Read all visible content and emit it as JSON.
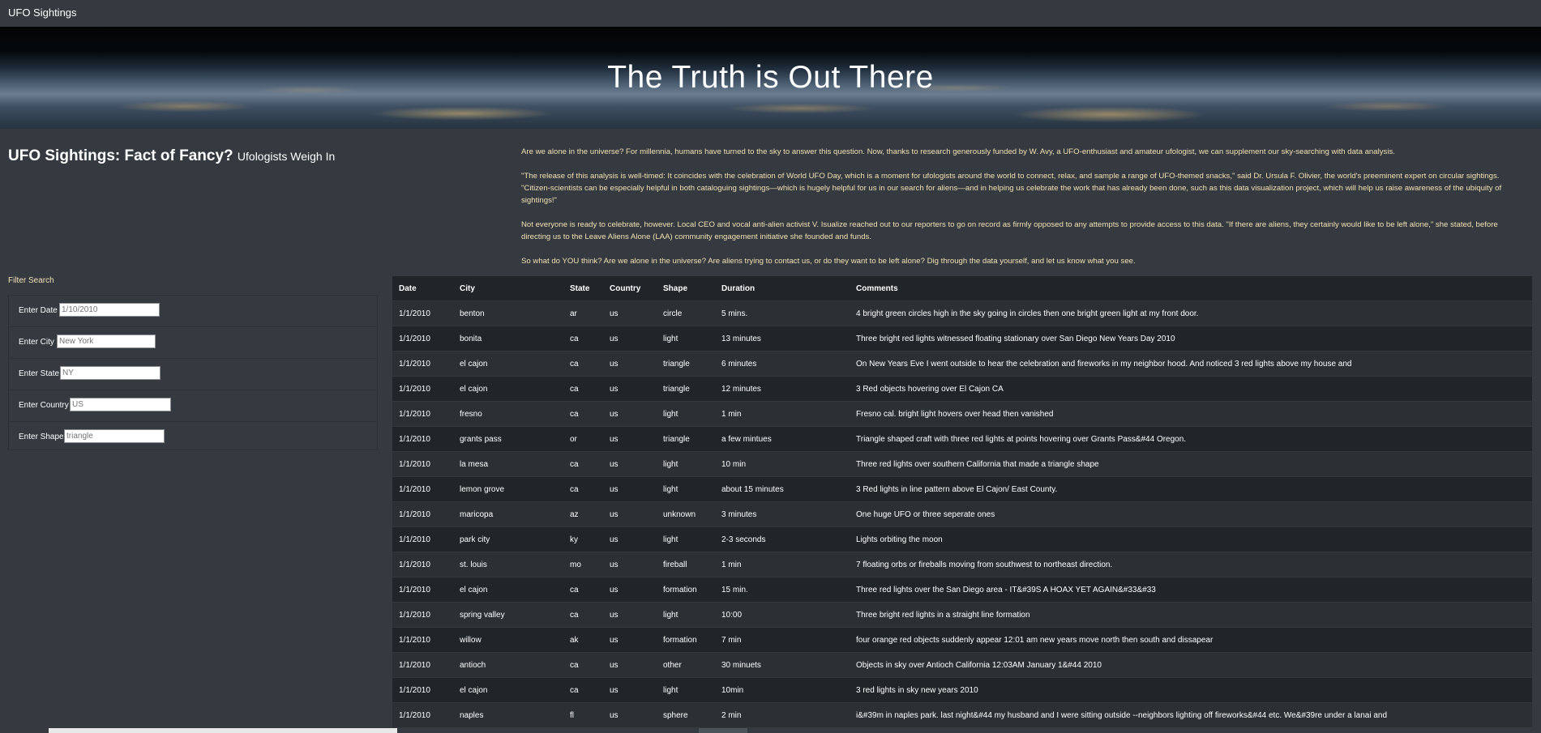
{
  "navbar": {
    "brand": "UFO Sightings"
  },
  "hero": {
    "title": "The Truth is Out There"
  },
  "intro": {
    "title": "UFO Sightings: Fact of Fancy?",
    "subtitle": "Ufologists Weigh In",
    "paragraphs": [
      "Are we alone in the universe? For millennia, humans have turned to the sky to answer this question. Now, thanks to research generously funded by W. Avy, a UFO-enthusiast and amateur ufologist, we can supplement our sky-searching with data analysis.",
      "\"The release of this analysis is well-timed: It coincides with the celebration of World UFO Day, which is a moment for ufologists around the world to connect, relax, and sample a range of UFO-themed snacks,\" said Dr. Ursula F. Olivier, the world's preeminent expert on circular sightings. \"Citizen-scientists can be especially helpful in both cataloguing sightings—which is hugely helpful for us in our search for aliens—and in helping us celebrate the work that has already been done, such as this data visualization project, which will help us raise awareness of the ubiquity of sightings!\"",
      "Not everyone is ready to celebrate, however. Local CEO and vocal anti-alien activist V. Isualize reached out to our reporters to go on record as firmly opposed to any attempts to provide access to this data. \"If there are aliens, they certainly would like to be left alone,\" she stated, before directing us to the Leave Aliens Alone (LAA) community engagement initiative she founded and funds.",
      "So what do YOU think? Are we alone in the universe? Are aliens trying to contact us, or do they want to be left alone? Dig through the data yourself, and let us know what you see."
    ]
  },
  "filters": {
    "label": "Filter Search",
    "date": {
      "label": "Enter Date",
      "placeholder": "1/10/2010"
    },
    "city": {
      "label": "Enter City",
      "placeholder": "New York"
    },
    "state": {
      "label": "Enter State",
      "placeholder": "NY"
    },
    "country": {
      "label": "Enter Country",
      "placeholder": "US"
    },
    "shape": {
      "label": "Enter Shape",
      "placeholder": "triangle"
    }
  },
  "table": {
    "headers": [
      "Date",
      "City",
      "State",
      "Country",
      "Shape",
      "Duration",
      "Comments"
    ],
    "rows": [
      [
        "1/1/2010",
        "benton",
        "ar",
        "us",
        "circle",
        "5 mins.",
        "4 bright green circles high in the sky going in circles then one bright green light at my front door."
      ],
      [
        "1/1/2010",
        "bonita",
        "ca",
        "us",
        "light",
        "13 minutes",
        "Three bright red lights witnessed floating stationary over San Diego New Years Day 2010"
      ],
      [
        "1/1/2010",
        "el cajon",
        "ca",
        "us",
        "triangle",
        "6 minutes",
        "On New Years Eve I went outside to hear the celebration and fireworks in my neighbor hood. And noticed 3 red lights above my house and"
      ],
      [
        "1/1/2010",
        "el cajon",
        "ca",
        "us",
        "triangle",
        "12 minutes",
        "3 Red objects hovering over El Cajon CA"
      ],
      [
        "1/1/2010",
        "fresno",
        "ca",
        "us",
        "light",
        "1 min",
        "Fresno cal. bright light hovers over head then vanished"
      ],
      [
        "1/1/2010",
        "grants pass",
        "or",
        "us",
        "triangle",
        "a few mintues",
        "Triangle shaped craft with three red lights at points hovering over Grants Pass&#44 Oregon."
      ],
      [
        "1/1/2010",
        "la mesa",
        "ca",
        "us",
        "light",
        "10 min",
        "Three red lights over southern California that made a triangle shape"
      ],
      [
        "1/1/2010",
        "lemon grove",
        "ca",
        "us",
        "light",
        "about 15 minutes",
        "3 Red lights in line pattern above El Cajon/ East County."
      ],
      [
        "1/1/2010",
        "maricopa",
        "az",
        "us",
        "unknown",
        "3 minutes",
        "One huge UFO or three seperate ones"
      ],
      [
        "1/1/2010",
        "park city",
        "ky",
        "us",
        "light",
        "2-3 seconds",
        "Lights orbiting the moon"
      ],
      [
        "1/1/2010",
        "st. louis",
        "mo",
        "us",
        "fireball",
        "1 min",
        "7 floating orbs or fireballs moving from southwest to northeast direction."
      ],
      [
        "1/1/2010",
        "el cajon",
        "ca",
        "us",
        "formation",
        "15 min.",
        "Three red lights over the San Diego area - IT&#39S A HOAX YET AGAIN&#33&#33"
      ],
      [
        "1/1/2010",
        "spring valley",
        "ca",
        "us",
        "light",
        "10:00",
        "Three bright red lights in a straight line formation"
      ],
      [
        "1/1/2010",
        "willow",
        "ak",
        "us",
        "formation",
        "7 min",
        "four orange red objects suddenly appear 12:01 am new years move north then south and dissapear"
      ],
      [
        "1/1/2010",
        "antioch",
        "ca",
        "us",
        "other",
        "30 minuets",
        "Objects in sky over Antioch California 12:03AM January 1&#44 2010"
      ],
      [
        "1/1/2010",
        "el cajon",
        "ca",
        "us",
        "light",
        "10min",
        "3 red lights in sky new years 2010"
      ],
      [
        "1/1/2010",
        "naples",
        "fl",
        "us",
        "sphere",
        "2 min",
        "i&#39m in naples park. last night&#44 my husband and I were sitting outside --neighbors lighting off fireworks&#44 etc. We&#39re under a lanai and"
      ]
    ]
  }
}
